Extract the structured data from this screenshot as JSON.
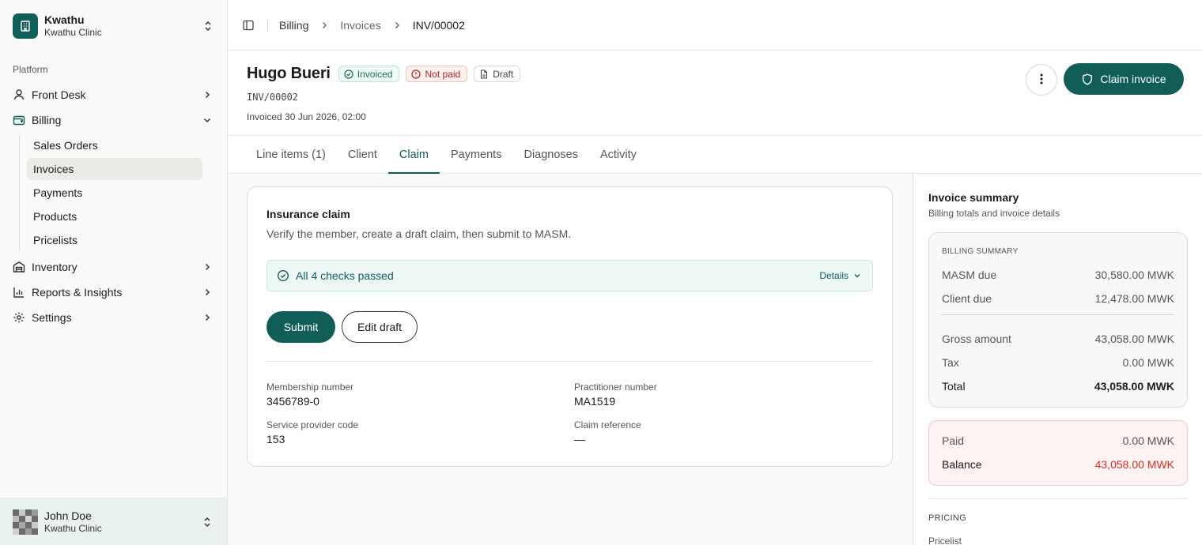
{
  "org": {
    "name": "Kwathu",
    "subtitle": "Kwathu Clinic"
  },
  "sidebar": {
    "section_label": "Platform",
    "items": [
      {
        "label": "Front Desk",
        "icon": "user-icon",
        "expanded": false
      },
      {
        "label": "Billing",
        "icon": "wallet-icon",
        "expanded": true,
        "children": [
          "Sales Orders",
          "Invoices",
          "Payments",
          "Products",
          "Pricelists"
        ],
        "active_child": "Invoices"
      },
      {
        "label": "Inventory",
        "icon": "warehouse-icon",
        "expanded": false
      },
      {
        "label": "Reports & Insights",
        "icon": "bar-chart-icon",
        "expanded": false
      },
      {
        "label": "Settings",
        "icon": "gear-icon",
        "expanded": false
      }
    ]
  },
  "user": {
    "name": "John Doe",
    "subtitle": "Kwathu Clinic"
  },
  "breadcrumb": [
    "Billing",
    "Invoices",
    "INV/00002"
  ],
  "invoice": {
    "patient_name": "Hugo Bueri",
    "badges": {
      "invoiced": "Invoiced",
      "not_paid": "Not paid",
      "draft": "Draft"
    },
    "number": "INV/00002",
    "invoiced_date": "Invoiced 30 Jun 2026, 02:00",
    "claim_button": "Claim invoice"
  },
  "tabs": [
    "Line items (1)",
    "Client",
    "Claim",
    "Payments",
    "Diagnoses",
    "Activity"
  ],
  "active_tab": "Claim",
  "claim": {
    "title": "Insurance claim",
    "description": "Verify the member, create a draft claim, then submit to MASM.",
    "checks_text": "All 4 checks passed",
    "details_label": "Details",
    "submit_label": "Submit",
    "edit_label": "Edit draft",
    "fields": {
      "membership_label": "Membership number",
      "membership_value": "3456789-0",
      "practitioner_label": "Practitioner number",
      "practitioner_value": "MA1519",
      "provider_label": "Service provider code",
      "provider_value": "153",
      "reference_label": "Claim reference",
      "reference_value": "—"
    }
  },
  "summary": {
    "title": "Invoice summary",
    "subtitle": "Billing totals and invoice details",
    "billing_head": "BILLING SUMMARY",
    "masm_due_label": "MASM due",
    "masm_due_value": "30,580.00 MWK",
    "client_due_label": "Client due",
    "client_due_value": "12,478.00 MWK",
    "gross_label": "Gross amount",
    "gross_value": "43,058.00 MWK",
    "tax_label": "Tax",
    "tax_value": "0.00 MWK",
    "total_label": "Total",
    "total_value": "43,058.00 MWK",
    "paid_label": "Paid",
    "paid_value": "0.00 MWK",
    "balance_label": "Balance",
    "balance_value": "43,058.00 MWK",
    "pricing_head": "PRICING",
    "pricelist_label": "Pricelist"
  },
  "colors": {
    "brand": "#115e59",
    "danger": "#d92d20"
  }
}
